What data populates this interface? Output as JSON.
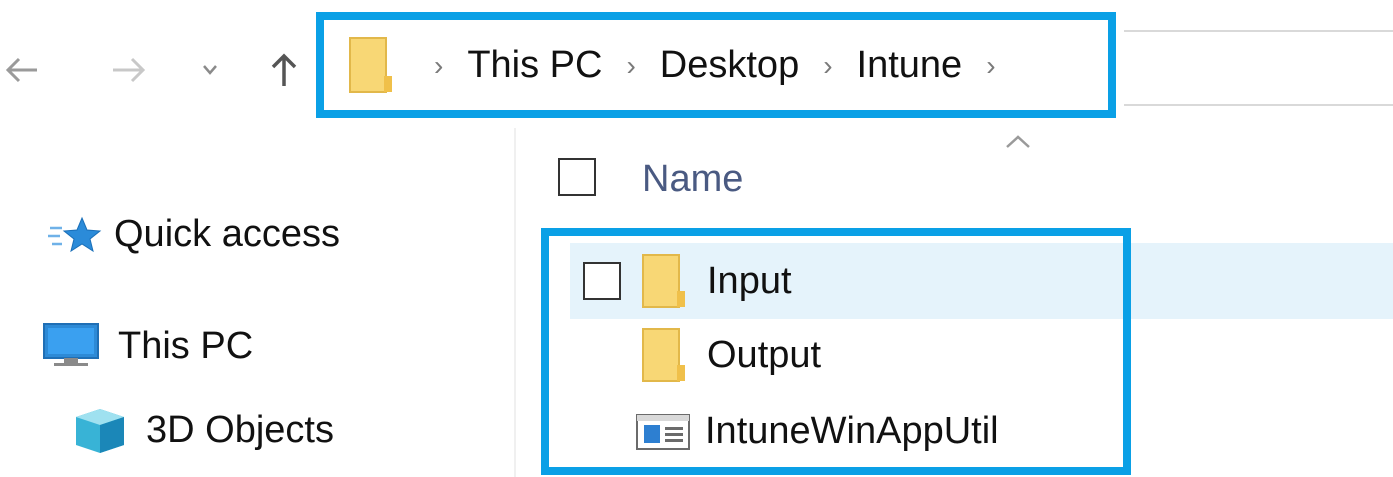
{
  "navigation_buttons": {
    "back": "back-arrow-icon",
    "forward": "forward-arrow-icon",
    "recent": "chevron-down-icon",
    "up": "up-arrow-icon"
  },
  "address_bar": {
    "root_icon": "folder-icon",
    "breadcrumbs": [
      "This PC",
      "Desktop",
      "Intune"
    ],
    "separator_icon": "chevron-right-icon"
  },
  "nav_pane": {
    "items": [
      {
        "label": "Quick access",
        "icon": "star-icon"
      },
      {
        "label": "This PC",
        "icon": "monitor-icon"
      },
      {
        "label": "3D Objects",
        "icon": "cube-icon"
      }
    ]
  },
  "file_list": {
    "column_header": "Name",
    "sort_indicator": "sort-up-caret-icon",
    "items": [
      {
        "name": "Input",
        "icon": "folder-icon",
        "hovered": true
      },
      {
        "name": "Output",
        "icon": "folder-icon"
      },
      {
        "name": "IntuneWinAppUtil",
        "icon": "application-icon"
      }
    ]
  },
  "colors": {
    "highlight_border": "#0aa0e6",
    "row_hover": "#e5f3fb",
    "folder_yellow": "#f8d775"
  }
}
